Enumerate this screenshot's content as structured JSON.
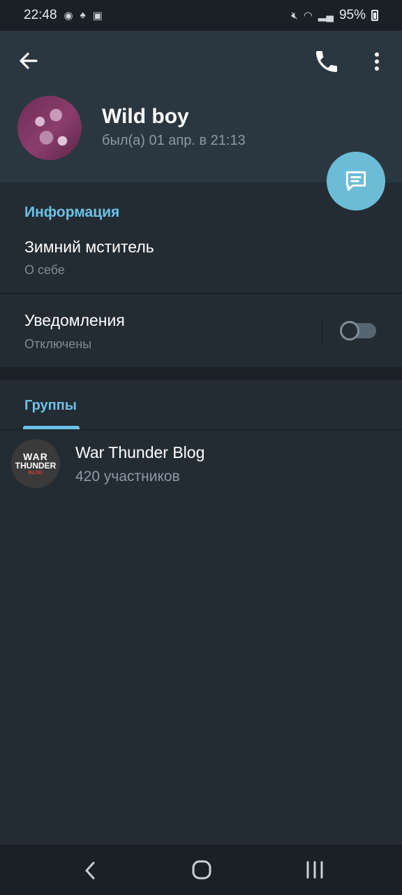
{
  "status_bar": {
    "time": "22:48",
    "battery": "95%",
    "left_icons": [
      "discord-icon",
      "notification-icon",
      "gallery-icon"
    ],
    "right_icons": [
      "mute-icon",
      "wifi-icon",
      "signal-icon",
      "battery-icon"
    ]
  },
  "header": {
    "back_icon": "arrow-left-icon",
    "call_icon": "phone-icon",
    "more_icon": "more-vertical-icon",
    "name": "Wild boy",
    "last_seen": "был(а) 01 апр. в 21:13",
    "fab_icon": "message-icon"
  },
  "info": {
    "section_title": "Информация",
    "bio_value": "Зимний мститель",
    "bio_label": "О себе",
    "notifications_title": "Уведомления",
    "notifications_status": "Отключены",
    "notifications_enabled": false
  },
  "groups": {
    "tab_label": "Группы",
    "items": [
      {
        "name": "War Thunder Blog",
        "members": "420 участников",
        "avatar_text": [
          "WAR",
          "THUNDER",
          "BLOG"
        ]
      }
    ]
  },
  "colors": {
    "accent": "#6cc2e6",
    "fab": "#6cbcd8",
    "header_bg": "#2b3740",
    "page_bg": "#232b33"
  },
  "nav_bar": {
    "icons": [
      "nav-back-icon",
      "nav-home-icon",
      "nav-recent-icon"
    ]
  }
}
